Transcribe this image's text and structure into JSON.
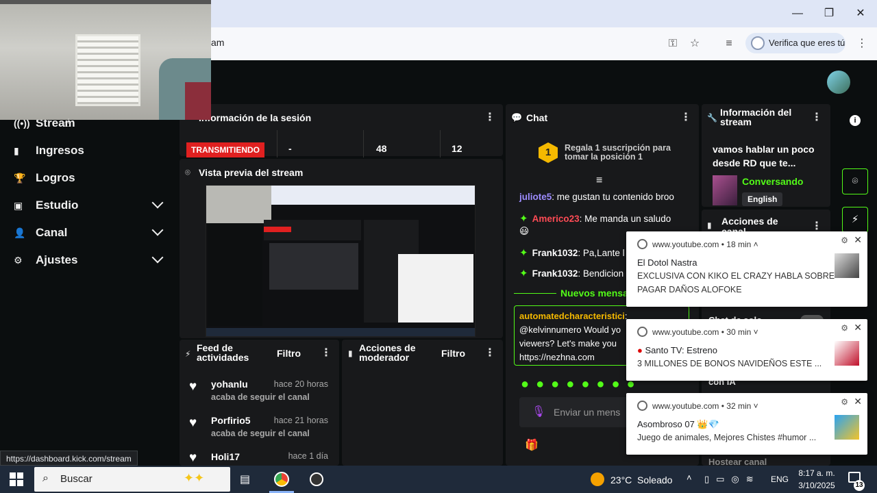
{
  "browser": {
    "url_fragment": "am",
    "verify_label": "Verifica que eres tú",
    "status_url": "https://dashboard.kick.com/stream"
  },
  "sidebar": {
    "items": [
      {
        "label": "Stream",
        "icon": "stream-icon"
      },
      {
        "label": "Ingresos",
        "icon": "chart-icon"
      },
      {
        "label": "Logros",
        "icon": "trophy-icon"
      },
      {
        "label": "Estudio",
        "icon": "studio-icon"
      },
      {
        "label": "Canal",
        "icon": "user-icon"
      },
      {
        "label": "Ajustes",
        "icon": "gear-icon"
      }
    ]
  },
  "session": {
    "title": "Información de la sesión",
    "live_badge": "TRANSMITIENDO",
    "stats": [
      "-",
      "48",
      "12"
    ]
  },
  "preview": {
    "title": "Vista previa del stream"
  },
  "feed": {
    "title_line1": "Feed de",
    "title_line2": "actividades",
    "filter": "Filtro",
    "items": [
      {
        "name": "yohanlu",
        "time": "hace 20 horas",
        "sub": "acaba de seguir el canal"
      },
      {
        "name": "Porfirio5",
        "time": "hace 21 horas",
        "sub": "acaba de seguir el canal"
      },
      {
        "name": "Holi17",
        "time": "hace 1 día",
        "sub": ""
      }
    ]
  },
  "mod": {
    "title_line1": "Acciones de",
    "title_line2": "moderador",
    "filter": "Filtro"
  },
  "chat": {
    "title": "Chat",
    "gift_rank": "1",
    "gift_text_line1": "Regala 1 suscripción para",
    "gift_text_line2": "tomar la posición 1",
    "messages": [
      {
        "user": "juliote5",
        "color": "#9d8cff",
        "text": ": me gustan tu contenido broo",
        "badge": false
      },
      {
        "user": "Americo23",
        "color": "#ff4b55",
        "text": ": Me manda un saludo",
        "badge": true
      },
      {
        "user": "Frank1032",
        "color": "#ffffff",
        "text": ": Pa,Lante l",
        "badge": true
      },
      {
        "user": "Frank1032",
        "color": "#ffffff",
        "text": ": Bendicion",
        "badge": true
      }
    ],
    "emoji_line": "😃",
    "new_messages": "Nuevos mensa",
    "pinned_user": "automatedcharacteristici",
    "pinned_text": [
      ":",
      "@kelvinnumero Would yo",
      "viewers? Let's make you",
      "https://nezhna.com"
    ],
    "input_placeholder": "Enviar un mens"
  },
  "stream_info": {
    "title_line1": "Información del",
    "title_line2": "stream",
    "stream_title_line1": "vamos hablar un poco",
    "stream_title_line2": "desde RD que te...",
    "category": "Conversando",
    "language": "English",
    "mod_actions_line1": "Acciones de",
    "mod_actions_line2": "canal"
  },
  "notifications": [
    {
      "source": "www.youtube.com",
      "age": "18 min",
      "title": "El Dotol Nastra",
      "body_line1": "EXCLUSIVA CON KIKO EL CRAZY HABLA SOBRE",
      "body_line2": "PAGAR DAÑOS ALOFOKE"
    },
    {
      "source": "www.youtube.com",
      "age": "30 min",
      "title": "Santo TV: Estreno",
      "body_line1": "3 MILLONES DE BONOS NAVIDEÑOS ESTE ...",
      "body_line2": ""
    },
    {
      "source": "www.youtube.com",
      "age": "32 min",
      "title": "Asombroso 07 👑💎",
      "body_line1": "Juego de animales, Mejores Chistes #humor ...",
      "body_line2": ""
    }
  ],
  "side_partial": {
    "chat_line": "Chat de solo",
    "ia_line": "con IA",
    "host_line": "Hostear canal"
  },
  "taskbar": {
    "search_placeholder": "Buscar",
    "weather": "23°C  Soleado",
    "lang": "ENG",
    "time": "8:17 a. m.",
    "date": "3/10/2025",
    "notif_count": "13"
  }
}
